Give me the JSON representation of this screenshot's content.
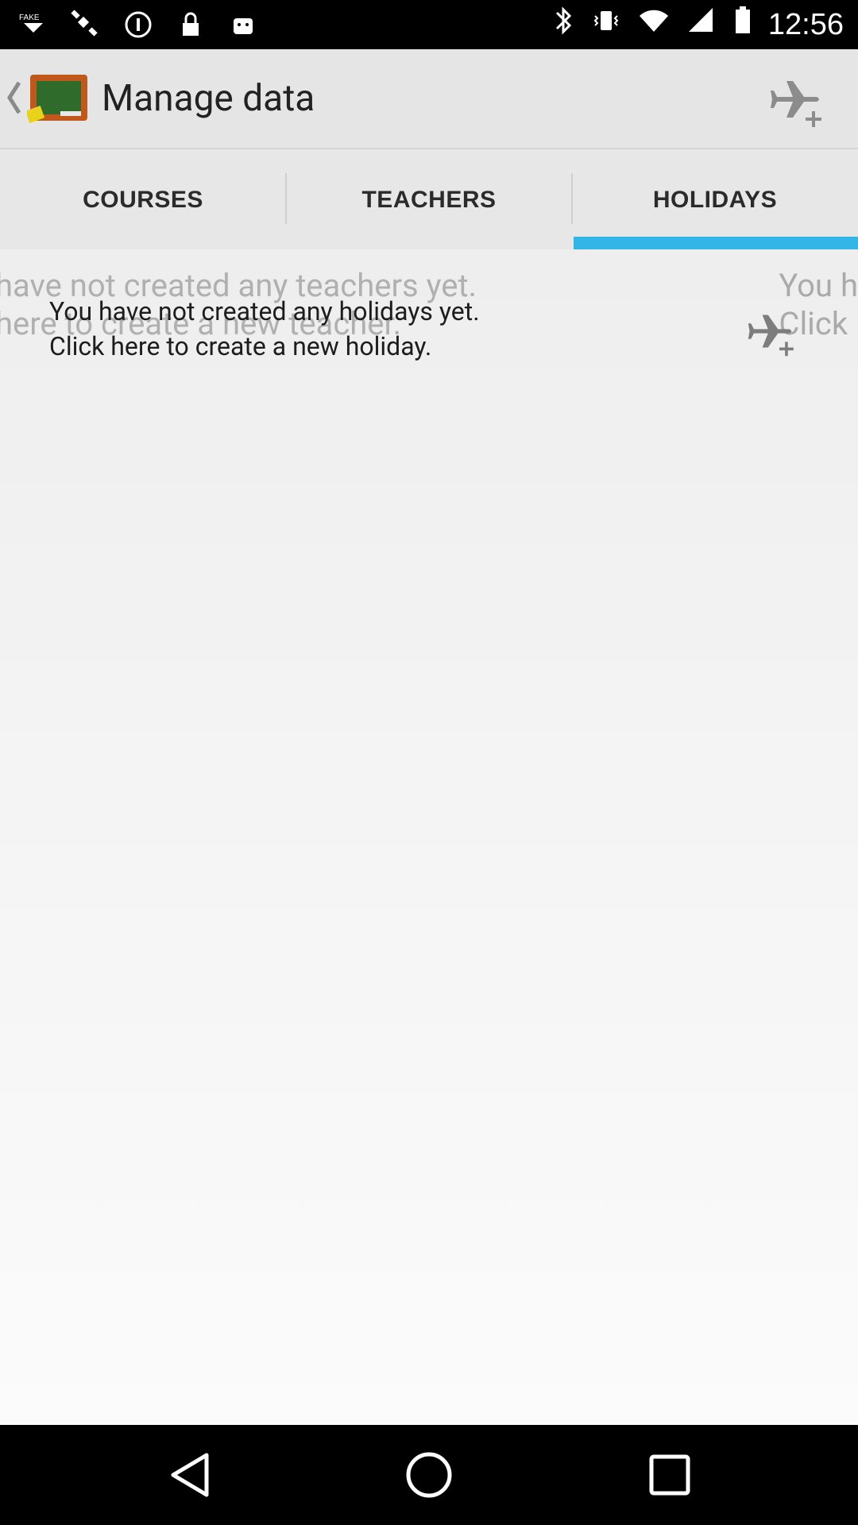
{
  "status_bar": {
    "time": "12:56",
    "left_icons": [
      "fake-gps-icon",
      "satellite-icon",
      "info-icon",
      "lock-icon",
      "android-icon"
    ],
    "right_icons": [
      "bluetooth-icon",
      "vibrate-icon",
      "wifi-icon",
      "signal-icon",
      "battery-icon"
    ]
  },
  "action_bar": {
    "title": "Manage data",
    "back_icon": "chevron-left-icon",
    "app_icon": "chalkboard-icon",
    "action_icon": "add-holiday-plane-icon"
  },
  "tabs": [
    {
      "label": "COURSES",
      "selected": false
    },
    {
      "label": "TEACHERS",
      "selected": false
    },
    {
      "label": "HOLIDAYS",
      "selected": true
    }
  ],
  "content": {
    "ghost_left_line1": "have not created any teachers yet.",
    "ghost_left_line2": "here to create a new teacher.",
    "ghost_right_line1": "You h",
    "ghost_right_line2": "Click",
    "empty_line1": "You have not created any holidays yet.",
    "empty_line2": "Click here to create a new holiday."
  },
  "colors": {
    "accent": "#33b5e5",
    "action_bar_bg": "#e5e5e5"
  }
}
